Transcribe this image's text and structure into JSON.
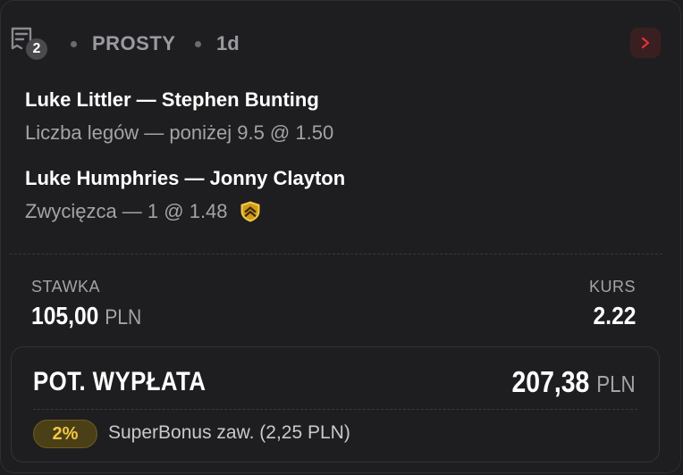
{
  "header": {
    "selection_count": "2",
    "bet_type": "PROSTY",
    "age": "1d"
  },
  "matches": [
    {
      "title": "Luke Littler — Stephen Bunting",
      "pick": "Liczba legów — poniżej 9.5 @ 1.50"
    },
    {
      "title": "Luke Humphries — Jonny Clayton",
      "pick": "Zwycięzca — 1 @ 1.48",
      "badge_icon": "shield-chevron-icon"
    }
  ],
  "stake": {
    "label": "STAWKA",
    "amount": "105,00",
    "currency": "PLN"
  },
  "odds": {
    "label": "KURS",
    "value": "2.22"
  },
  "payout": {
    "label": "POT. WYPŁATA",
    "amount": "207,38",
    "currency": "PLN"
  },
  "bonus": {
    "percent": "2%",
    "text": "SuperBonus zaw. (2,25 PLN)"
  },
  "colors": {
    "accent_red": "#e0313a",
    "bonus_gold": "#f2c744",
    "background": "#1e1e20"
  }
}
